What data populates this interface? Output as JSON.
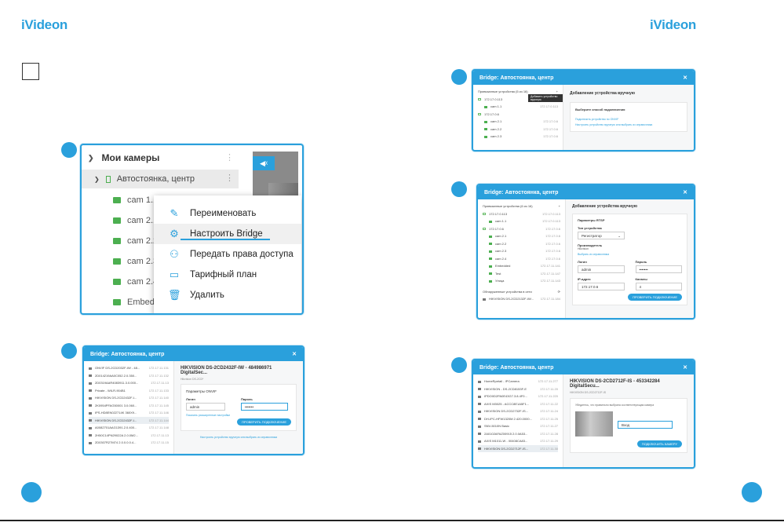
{
  "brand": {
    "logo_text": "iVideon"
  },
  "menu_panel": {
    "tree_title": "Мои камеры",
    "group_name": "Автостоянка, центр",
    "cameras": [
      "cam 1.1",
      "cam 2.1",
      "cam 2.2",
      "cam 2.3",
      "cam 2.4",
      "Embedded"
    ],
    "menu_items": [
      {
        "label": "Переименовать",
        "icon": "pencil-icon"
      },
      {
        "label": "Настроить Bridge",
        "icon": "gear-icon"
      },
      {
        "label": "Передать права доступа",
        "icon": "user-plus-icon"
      },
      {
        "label": "Тарифный план",
        "icon": "calendar-icon"
      },
      {
        "label": "Удалить",
        "icon": "trash-icon"
      }
    ]
  },
  "dialog_title": "Bridge: Автостоянка, центр",
  "close_symbol": "✕",
  "add_plus": "+",
  "panel_a": {
    "left_header": "Привязанные устройства (5 из 16)",
    "tooltip": "Добавить устройство вручную",
    "rows": [
      {
        "name": "172.17.0.113",
        "ip": "",
        "group": true
      },
      {
        "name": "cam 1.1",
        "ip": "172.17.0.113"
      },
      {
        "name": "172.17.0.6",
        "ip": "",
        "group": true
      },
      {
        "name": "cam 2.1",
        "ip": "172.17.0.6"
      },
      {
        "name": "cam 2.2",
        "ip": "172.17.0.6"
      },
      {
        "name": "cam 2.3",
        "ip": "172.17.0.6"
      }
    ],
    "right_title": "Добавление устройства вручную",
    "card_title": "Выберите способ подключения",
    "link1": "Подключить устройство по ONVIF",
    "link2": "Настроить устройство вручную или выбрать из справочника"
  },
  "panel_b": {
    "left_header": "Привязанные устройства (6 из 16)",
    "rows": [
      {
        "name": "172.17.0.113",
        "ip": "172.17.0.113",
        "group": true
      },
      {
        "name": "cam 1.1",
        "ip": "172.17.0.113"
      },
      {
        "name": "172.17.0.6",
        "ip": "172.17.0.6",
        "group": true
      },
      {
        "name": "cam 2.1",
        "ip": "172.17.0.6"
      },
      {
        "name": "cam 2.2",
        "ip": "172.17.0.6"
      },
      {
        "name": "cam 2.3",
        "ip": "172.17.0.6"
      },
      {
        "name": "cam 2.4",
        "ip": "172.17.0.6"
      },
      {
        "name": "Embedded",
        "ip": "172.17.11.141"
      },
      {
        "name": "Test",
        "ip": "172.17.11.147"
      },
      {
        "name": "Улица",
        "ip": "172.17.11.143"
      }
    ],
    "discovered_header": "Обнаруженные устройства в сети",
    "discovered_row": {
      "name": "HIKVISION DS-2CD2132F-IW...",
      "ip": "172.17.11.184"
    },
    "right_title": "Добавление устройства вручную",
    "card_title": "Параметры RTSP",
    "type_label": "Тип устройства",
    "type_value": "Регистратор",
    "vendor_label": "Производитель",
    "vendor_value": "Hikvision",
    "vendor_link": "Выбрать из справочника",
    "login_label": "Логин",
    "login_value": "admin",
    "password_label": "Пароль",
    "password_value": "•••••••",
    "ip_label": "IP-адрес",
    "ip_value": "172.17.0.6",
    "channels_label": "Каналы",
    "channels_value": "4",
    "submit": "ПРОВЕРИТЬ ПОДКЛЮЧЕНИЕ"
  },
  "panel_c": {
    "rows": [
      {
        "name": "ONVIF DS-2CD2032F-IW - 48...",
        "ip": "172.17.11.131"
      },
      {
        "name": "2D014219AA0C052.2.0.350...",
        "ip": "172.17.11.132"
      },
      {
        "name": "2D0319AAR4083911.3.0.000...",
        "ip": "172.17.11.13"
      },
      {
        "name": "Private - WILR-904B1",
        "ip": "172.17.11.133"
      },
      {
        "name": "HIKVISION DS-2CD2432F-I...",
        "ip": "172.17.11.140"
      },
      {
        "name": "2K0954PFAG50001 3.0.060...",
        "ip": "172.17.11.145"
      },
      {
        "name": "IPS-HD8EN022714K 360X9...",
        "ip": "172.17.11.146"
      },
      {
        "name": "HIKVISION DS-2CD2432F-I...",
        "ip": "172.17.11.144",
        "sel": true
      },
      {
        "name": "A0082701AAG1391.2.0.400...",
        "ip": "172.17.11.148"
      },
      {
        "name": "2H50C14PN29022A 2.0.0M2...",
        "ip": "172.17.11.13"
      },
      {
        "name": "2D0307R27M74 2.0.0.0.0.4...",
        "ip": "172.17.11.15"
      }
    ],
    "right_title": "HIKVISION DS-2CD2432F-IW - 484986971 DigitalSec...",
    "subtitle": "Hikvision DS-2CD*",
    "card_title": "Параметры ONVIF",
    "login_label": "Логин",
    "login_value": "admin",
    "password_label": "Пароль",
    "password_value": "•••••••",
    "link": "Показать расширенные настройки",
    "submit": "ПРОВЕРИТЬ ПОДКЛЮЧЕНИЕ",
    "footer_link": "Настроить устройство вручную или выбрать из справочника"
  },
  "panel_d": {
    "rows": [
      {
        "name": "HomeRpetail - IPCamera",
        "ip": "172.17.11.277"
      },
      {
        "name": "HIKVISION - DS-2CD8153F-E",
        "ip": "172.17.11.20"
      },
      {
        "name": "IPDO0D2PA0E43G7.3.8.4F0...",
        "ip": "172.17.11.220"
      },
      {
        "name": "AXIS M3025 - ACCC8E1A5F1...",
        "ip": "172.17.11.22"
      },
      {
        "name": "HIKVISION DS-2CD2732F-IS...",
        "ip": "172.17.11.24"
      },
      {
        "name": "DH-IPC-HFW1320M 2.420.0000...",
        "ip": "172.17.11.25"
      },
      {
        "name": "SNV-5010N Basic",
        "ip": "172.17.11.27"
      },
      {
        "name": "2A0102AFAZ00915 2.0.0A53...",
        "ip": "172.17.11.28"
      },
      {
        "name": "AXIS M1011-W - 00408CA83...",
        "ip": "172.17.11.29"
      },
      {
        "name": "HIKVISION DS-2CD2712F-IS...",
        "ip": "172.17.11.30",
        "sel": true
      }
    ],
    "right_title": "HIKVISION DS-2CD2712F-IS - 453342284 DigitalSecu...",
    "subtitle": "HIKVISION DS-2CD2712F-IS",
    "hint": "Убедитесь, что правильно выбрана соответствующая камера",
    "name_value": "Вход",
    "submit": "ПОДКЛЮЧИТЬ КАМЕРУ"
  }
}
